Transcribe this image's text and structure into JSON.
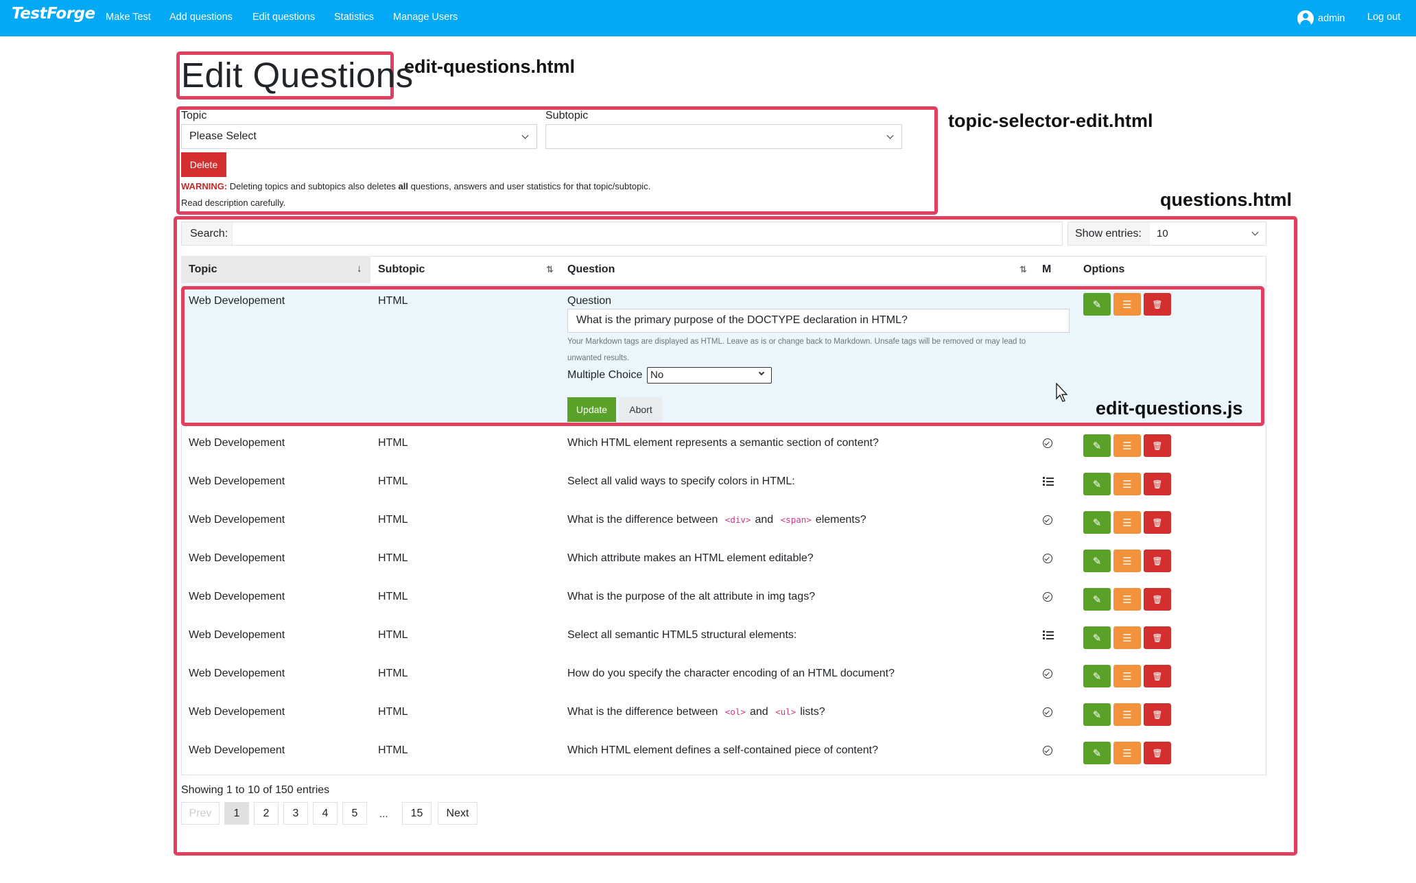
{
  "navbar": {
    "brand": "TestForge",
    "links": [
      "Make Test",
      "Add questions",
      "Edit questions",
      "Statistics",
      "Manage Users"
    ],
    "user": "admin",
    "logout": "Log out"
  },
  "annotations": {
    "edit_questions_html": "edit-questions.html",
    "topic_selector_edit_html": "topic-selector-edit.html",
    "questions_html": "questions.html",
    "edit_questions_js": "edit-questions.js"
  },
  "page_title": "Edit Questions",
  "topic_selector": {
    "topic_label": "Topic",
    "topic_value": "Please Select",
    "subtopic_label": "Subtopic",
    "subtopic_value": "",
    "delete_label": "Delete",
    "warning_prefix": "WARNING:",
    "warning_text_a": " Deleting topics and subtopics also deletes ",
    "warning_bold": "all",
    "warning_text_b": " questions, answers and user statistics for that topic/subtopic.",
    "read_description": "Read description carefully."
  },
  "controls": {
    "search_label": "Search:",
    "search_value": "",
    "entries_label": "Show entries:",
    "entries_value": "10"
  },
  "table": {
    "headers": {
      "topic": "Topic",
      "subtopic": "Subtopic",
      "question": "Question",
      "m": "M",
      "options": "Options"
    },
    "edit_row": {
      "topic": "Web Developement",
      "subtopic": "HTML",
      "question_label": "Question",
      "question_value": "What is the primary purpose of the DOCTYPE declaration in HTML?",
      "note_line1": "Your Markdown tags are displayed as HTML. Leave as is or change back to Markdown. Unsafe tags will be removed or may lead to",
      "note_line2": "unwanted results.",
      "mc_label": "Multiple Choice",
      "mc_value": "No",
      "update_label": "Update",
      "abort_label": "Abort"
    },
    "rows": [
      {
        "topic": "Web Developement",
        "subtopic": "HTML",
        "q_pre": "Which HTML element represents a semantic section of content?",
        "m": "single-choice-icon"
      },
      {
        "topic": "Web Developement",
        "subtopic": "HTML",
        "q_pre": "Select all valid ways to specify colors in HTML:",
        "m": "multiple-choice-icon"
      },
      {
        "topic": "Web Developement",
        "subtopic": "HTML",
        "q_pre": "What is the difference between",
        "code1": "<div>",
        "q_mid": "and",
        "code2": "<span>",
        "q_post": "elements?",
        "m": "single-choice-icon"
      },
      {
        "topic": "Web Developement",
        "subtopic": "HTML",
        "q_pre": "Which attribute makes an HTML element editable?",
        "m": "single-choice-icon"
      },
      {
        "topic": "Web Developement",
        "subtopic": "HTML",
        "q_pre": "What is the purpose of the alt attribute in img tags?",
        "m": "single-choice-icon"
      },
      {
        "topic": "Web Developement",
        "subtopic": "HTML",
        "q_pre": "Select all semantic HTML5 structural elements:",
        "m": "multiple-choice-icon"
      },
      {
        "topic": "Web Developement",
        "subtopic": "HTML",
        "q_pre": "How do you specify the character encoding of an HTML document?",
        "m": "single-choice-icon"
      },
      {
        "topic": "Web Developement",
        "subtopic": "HTML",
        "q_pre": "What is the difference between",
        "code1": "<ol>",
        "q_mid": "and",
        "code2": "<ul>",
        "q_post": "lists?",
        "m": "single-choice-icon"
      },
      {
        "topic": "Web Developement",
        "subtopic": "HTML",
        "q_pre": "Which HTML element defines a self-contained piece of content?",
        "m": "single-choice-icon"
      }
    ]
  },
  "pagination": {
    "showing": "Showing 1 to 10 of 150 entries",
    "prev": "Prev",
    "pages": [
      "1",
      "2",
      "3",
      "4",
      "5"
    ],
    "ellipsis": "...",
    "last": "15",
    "next": "Next"
  },
  "colors": {
    "navbar": "#03a9f4",
    "annotation": "#e0405e",
    "edit_green": "#5aa12a",
    "list_orange": "#f4913b",
    "delete_red": "#d32f2f"
  }
}
